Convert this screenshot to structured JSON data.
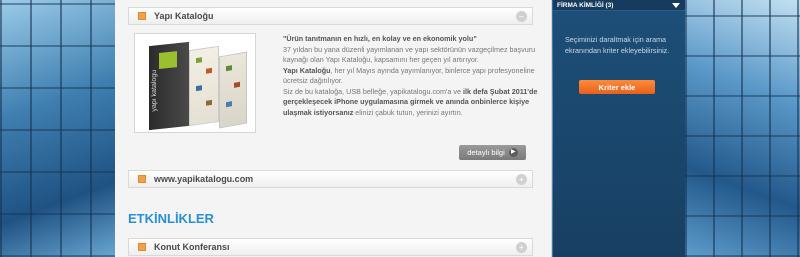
{
  "sections": {
    "yapi_katalogu": {
      "title": "Yapı Kataloğu"
    },
    "website": {
      "title": "www.yapikatalogu.com"
    },
    "konut": {
      "title": "Konut Konferansı"
    }
  },
  "catalog": {
    "cover_text": "yapı katalogu",
    "para1_bold": "\"Ürün tanıtmanın en hızlı, en kolay ve en ekonomik yolu\"",
    "para1_rest": "37 yıldan bu yana düzenli yayımlanan ve yapı sektörünün vazgeçilmez başvuru kaynağı olan Yapı Kataloğu, kapsamını her geçen yıl artırıyor.",
    "para2_bold": "Yapı Kataloğu",
    "para2_rest": ", her yıl Mayıs ayında yayımlanıyor, binlerce yapı profesyoneline ücretsiz dağıtılıyor.",
    "para3_pre": "Siz de bu kataloğa, USB belleğe, yapikatalogu.com'a ve ",
    "para3_bold": "ilk defa Şubat 2011'de gerçekleşecek iPhone uygulamasına girmek ve anında onbinlerce kişiye ulaşmak istiyorsanız",
    "para3_post": " elinizi çabuk tutun, yerinizi ayırtın.",
    "detail_label": "detaylı bilgi"
  },
  "events": {
    "heading": "ETKİNLİKLER"
  },
  "sidebar": {
    "header": "FİRMA KİMLİĞİ (3)",
    "hint": "Seçiminizi daraltmak için arama ekranından kriter ekleyebilirsiniz.",
    "button": "Kriter ekle"
  },
  "colors": {
    "accent_orange": "#e8601a",
    "heading_blue": "#2a8fd4",
    "sidebar_bg": "#1d4f78"
  }
}
